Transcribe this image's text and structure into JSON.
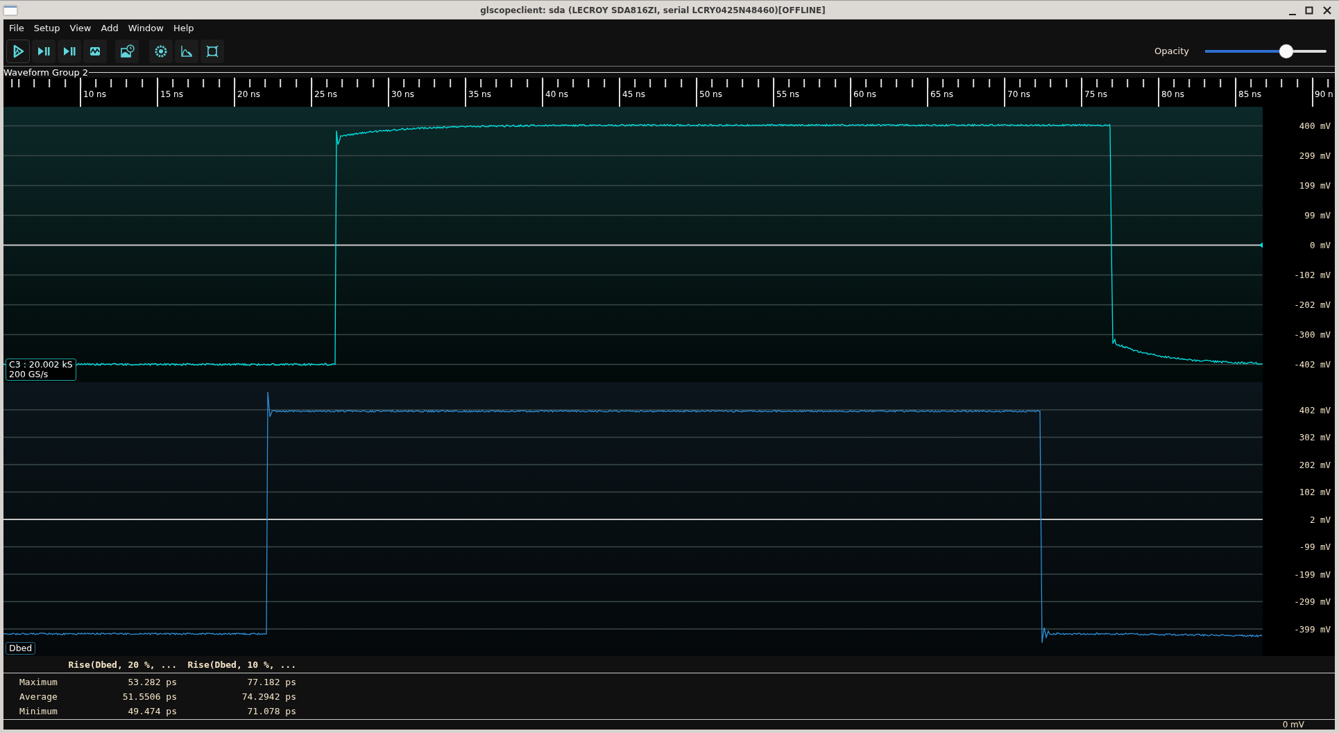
{
  "window": {
    "title": "glscopeclient: sda (LECROY SDA816ZI, serial LCRY0425N48460)[OFFLINE]"
  },
  "menu": [
    "File",
    "Setup",
    "View",
    "Add",
    "Window",
    "Help"
  ],
  "toolbar": {
    "opacity": {
      "label": "Opacity",
      "level": 0.67
    }
  },
  "waveform_group": {
    "title": "Waveform Group 2",
    "time_axis": [
      "10 ns",
      "15 ns",
      "20 ns",
      "25 ns",
      "30 ns",
      "35 ns",
      "40 ns",
      "45 ns",
      "50 ns",
      "55 ns",
      "60 ns",
      "65 ns",
      "70 ns",
      "75 ns",
      "80 ns",
      "85 ns",
      "90 n"
    ],
    "plots": [
      {
        "channel_label": [
          "C3 : 20.002 kS",
          "200 GS/s"
        ],
        "color": "#00e6e6",
        "offset_marker": true,
        "y_axis": [
          "400 mV",
          "299 mV",
          "199 mV",
          "99 mV",
          "0 mV",
          "-102 mV",
          "-202 mV",
          "-300 mV",
          "-402 mV"
        ]
      },
      {
        "channel_label": [
          "Dbed"
        ],
        "color": "#2f8fd8",
        "offset_marker": false,
        "y_axis": [
          "402 mV",
          "302 mV",
          "202 mV",
          "102 mV",
          "2 mV",
          "-99 mV",
          "-199 mV",
          "-299 mV",
          "-399 mV"
        ]
      }
    ]
  },
  "measurements": {
    "columns": [
      "Rise(Dbed, 20 %, ...",
      "Rise(Dbed, 10 %, ..."
    ],
    "rows": [
      {
        "label": "Maximum",
        "values": [
          "53.282 ps",
          "77.182 ps"
        ]
      },
      {
        "label": "Average",
        "values": [
          "51.5506 ps",
          "74.2942 ps"
        ]
      },
      {
        "label": "Minimum",
        "values": [
          "49.474 ps",
          "71.078 ps"
        ]
      }
    ]
  },
  "status_bar": {
    "reading": "0 mV"
  }
}
